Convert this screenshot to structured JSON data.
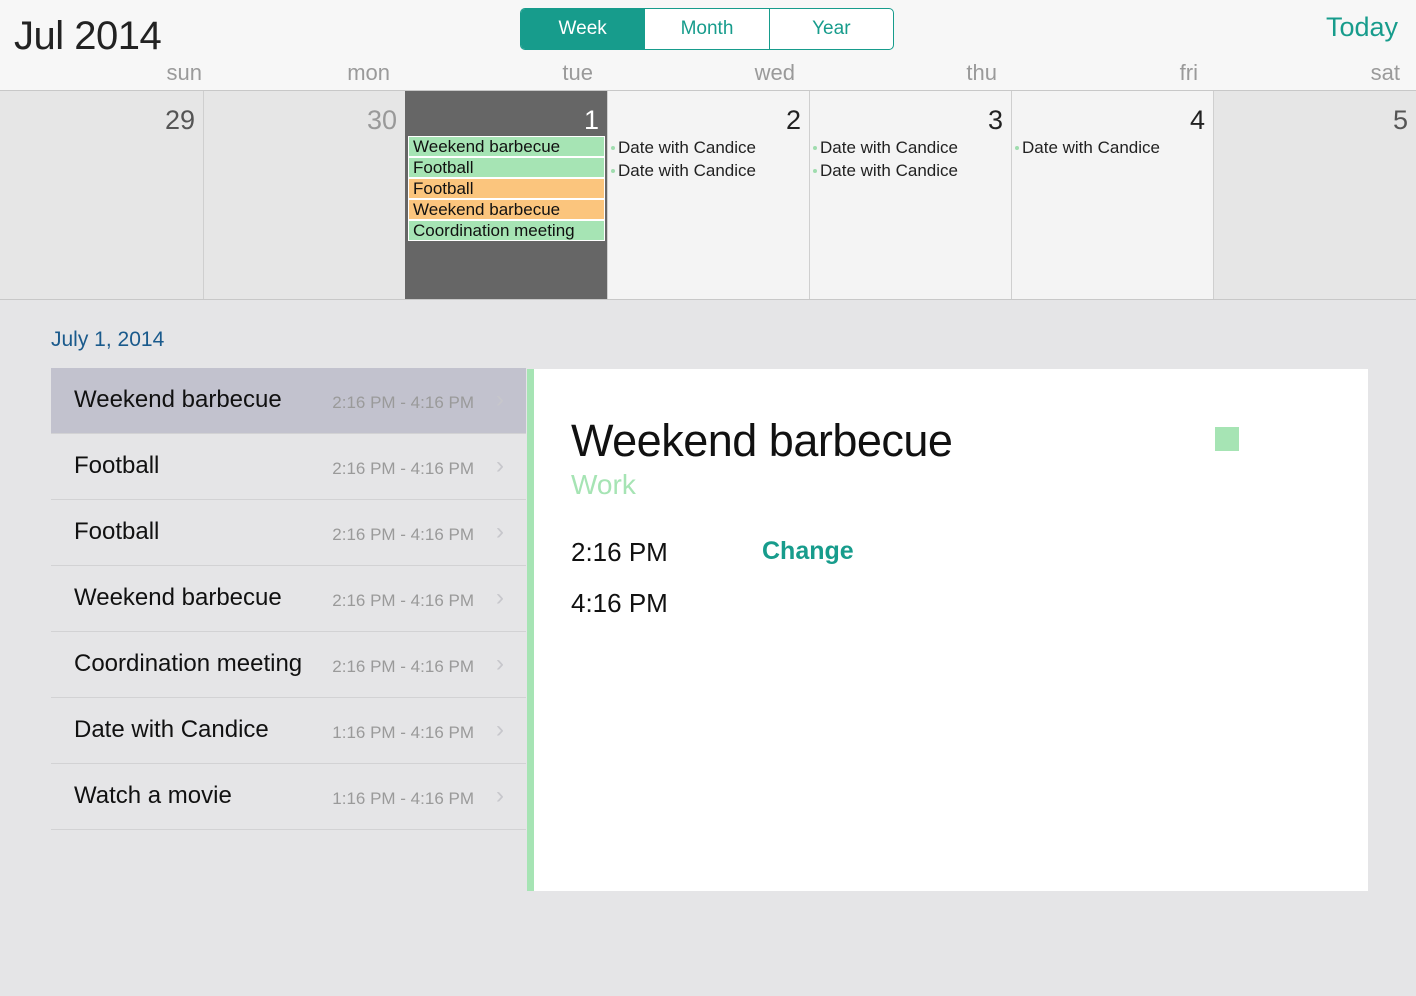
{
  "header": {
    "month_title": "Jul 2014",
    "view_tabs": [
      {
        "label": "Week",
        "active": true
      },
      {
        "label": "Month",
        "active": false
      },
      {
        "label": "Year",
        "active": false
      }
    ],
    "today_label": "Today",
    "accent_color": "#179c8c"
  },
  "week": {
    "weekdays": [
      "sun",
      "mon",
      "tue",
      "wed",
      "thu",
      "fri",
      "sat"
    ],
    "days": [
      {
        "num": "29",
        "events": []
      },
      {
        "num": "30",
        "events": []
      },
      {
        "num": "1",
        "selected": true,
        "events": [
          "Weekend barbecue",
          "Football",
          "Football",
          "Weekend barbecue",
          "Coordination meeting"
        ]
      },
      {
        "num": "2",
        "events": [
          "Date with Candice",
          "Date with Candice"
        ]
      },
      {
        "num": "3",
        "events": [
          "Date with Candice",
          "Date with Candice"
        ]
      },
      {
        "num": "4",
        "events": [
          "Date with Candice"
        ]
      },
      {
        "num": "5",
        "events": []
      }
    ]
  },
  "day_list": {
    "date_heading": "July 1, 2014",
    "items": [
      {
        "title": "Weekend barbecue",
        "time": "2:16 PM - 4:16 PM"
      },
      {
        "title": "Football",
        "time": "2:16 PM - 4:16 PM"
      },
      {
        "title": "Football",
        "time": "2:16 PM - 4:16 PM"
      },
      {
        "title": "Weekend barbecue",
        "time": "2:16 PM - 4:16 PM"
      },
      {
        "title": "Coordination meeting",
        "time": "2:16 PM - 4:16 PM"
      },
      {
        "title": "Date with Candice",
        "time": "1:16 PM - 4:16 PM"
      },
      {
        "title": "Watch a movie",
        "time": "1:16 PM - 4:16 PM"
      }
    ]
  },
  "detail": {
    "title": "Weekend barbecue",
    "calendar": "Work",
    "start_time": "2:16 PM",
    "end_time": "4:16 PM",
    "change_label": "Change",
    "calendar_color": "#a6e4b4"
  },
  "colors": {
    "green_event": "#a6e4b4",
    "orange_event": "#fbc57d"
  }
}
